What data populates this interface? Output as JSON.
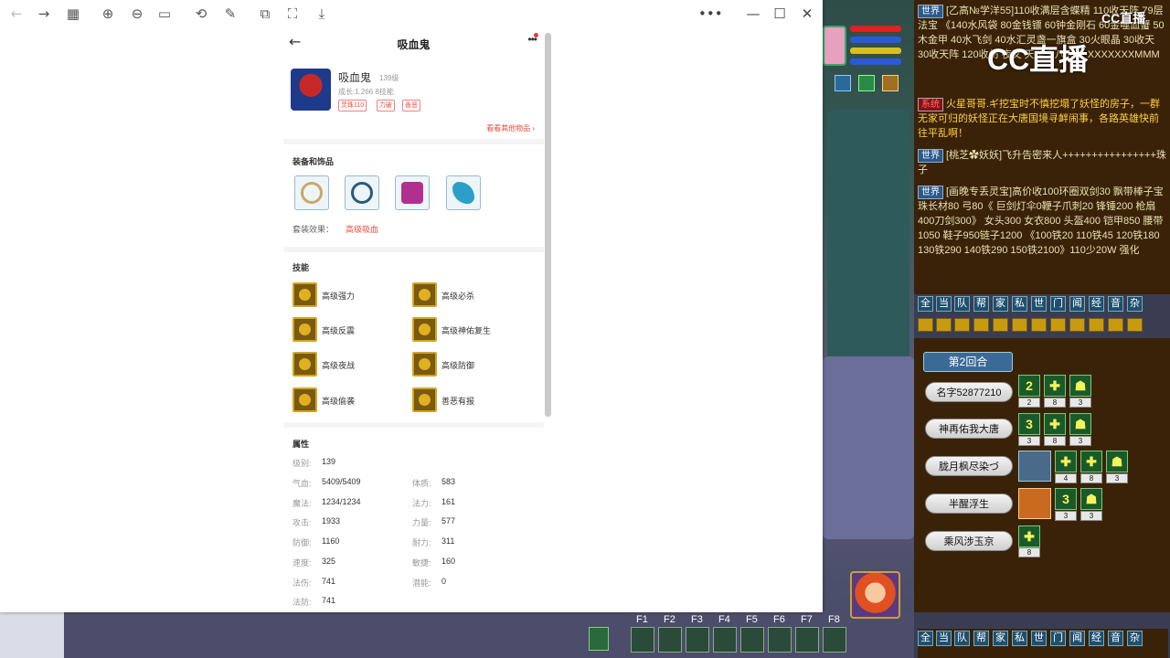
{
  "viewer": {
    "toolbar_icons": [
      "back-arrow-icon",
      "forward-arrow-icon",
      "grid-icon",
      "zoom-in-icon",
      "zoom-out-icon",
      "fit-page-icon",
      "rotate-icon",
      "annotate-icon",
      "split-icon",
      "fullscreen-icon",
      "download-icon"
    ],
    "more_label": "•••",
    "minimize_label": "—",
    "maximize_label": "☐",
    "close_label": "✕"
  },
  "app": {
    "title": "吸血鬼",
    "back": "←",
    "pet": {
      "name": "吸血鬼",
      "level": "139级",
      "growth": "成长:1.266 8技能",
      "tags": [
        "灵珠110",
        "力破",
        "善恶"
      ]
    },
    "see_other": "看看其他物品 ›",
    "equip_title": "装备和饰品",
    "set_label": "套装效果：",
    "set_value": "高级吸血",
    "skills_title": "技能",
    "skills": [
      "高级强力",
      "高级必杀",
      "高级反震",
      "高级神佑复生",
      "高级夜战",
      "高级防御",
      "高级偷袭",
      "善恶有报"
    ],
    "attrs_title": "属性",
    "attrs": {
      "level_label": "级别:",
      "level": "139",
      "hp_label": "气血:",
      "hp": "5409/5409",
      "phys_label": "体质:",
      "phys": "583",
      "mp_label": "魔法:",
      "mp": "1234/1234",
      "magic_label": "法力:",
      "magic": "161",
      "atk_label": "攻击:",
      "atk": "1933",
      "str_label": "力量:",
      "str": "577",
      "def_label": "防御:",
      "def": "1160",
      "end_label": "耐力:",
      "end": "311",
      "spd_label": "速度:",
      "spd": "325",
      "agi_label": "敏捷:",
      "agi": "160",
      "mdmg_label": "法伤:",
      "mdmg": "741",
      "pot_label": "潜能:",
      "pot": "0",
      "mdef_label": "法防:",
      "mdef": "741"
    }
  },
  "chat": {
    "world_tag": "世界",
    "sys_tag": "系统",
    "line1": "[乙高№学洋55]110收满层含蝶精 110收天阵 79层法宝 《140水风袋 80金钱镖 60钟金刚石 60金噬血蟹 50木金甲 40水飞剑 40水汇灵盏一旗盒 30火眼晶 30收天 30收天阵 120收伤 夜叉 天罡十八大法 XXXXXXXMMM",
    "line2": "火星哥哥.ギ挖宝时不慎挖塌了妖怪的房子，一群无家可归的妖怪正在大唐国境寻衅闹事，各路英雄快前往平乱啊！",
    "line3": "[桃芝✿妖妖]飞升告密来人++++++++++++++++珠子",
    "line4": "[画晚专丢灵宝]高价收100环圈双剑30 飘带棒子宝珠长材80 弓80《 巨剑灯伞0鞭子爪刺20 锋锤200 枪扇400刀剑300》 女头300 女衣800 头盔400 铠甲850 腰带1050 鞋子950链子1200 《100铁20 110铁45 120铁180 130铁290 140铁290 150铁2100》110少20W 强化",
    "logo": "CC直播",
    "logo_small": "CC直播",
    "buttons": [
      "全",
      "当",
      "队",
      "帮",
      "家",
      "私",
      "世",
      "门",
      "闻",
      "经",
      "音",
      "杂"
    ]
  },
  "battle": {
    "round": "第2回合",
    "players": [
      {
        "name": "名字52877210",
        "statuses": [
          {
            "icon": "2",
            "count": "2"
          },
          {
            "icon": "✚",
            "count": "8"
          },
          {
            "icon": "☗",
            "count": "3"
          }
        ]
      },
      {
        "name": "神再佑我大唐",
        "statuses": [
          {
            "icon": "3",
            "count": "3"
          },
          {
            "icon": "✚",
            "count": "8"
          },
          {
            "icon": "☗",
            "count": "3"
          }
        ]
      },
      {
        "name": "胧月枫尽染づ",
        "statuses": [
          {
            "icon": "✚",
            "count": "4"
          },
          {
            "icon": "✚",
            "count": "8"
          },
          {
            "icon": "☗",
            "count": "3"
          }
        ]
      },
      {
        "name": "半醒浮生",
        "statuses": [
          {
            "icon": "3",
            "count": "3"
          },
          {
            "icon": "☗",
            "count": "3"
          }
        ]
      },
      {
        "name": "乘风涉玉京",
        "statuses": [
          {
            "icon": "✚",
            "count": "8"
          }
        ]
      }
    ]
  },
  "fkeys": [
    "F1",
    "F2",
    "F3",
    "F4",
    "F5",
    "F6",
    "F7",
    "F8"
  ]
}
